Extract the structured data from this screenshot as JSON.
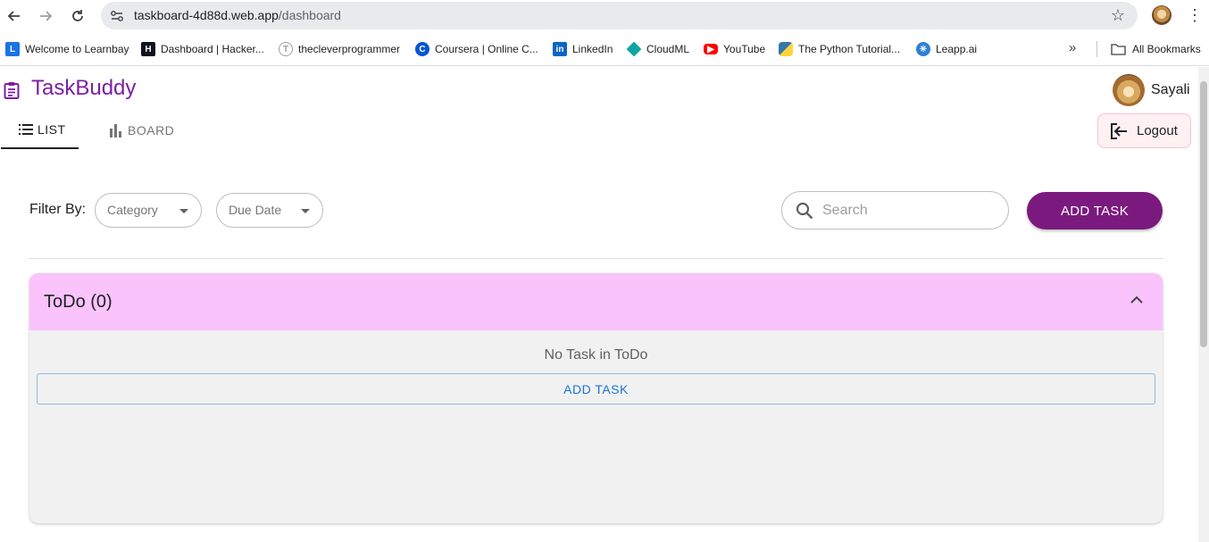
{
  "browser": {
    "url_host": "taskboard-4d88d.web.app",
    "url_path": "/dashboard",
    "bookmarks": [
      {
        "label": "Welcome to Learnbay",
        "icon": "learnbay-icon",
        "color": "#1a73e8"
      },
      {
        "label": "Dashboard | Hacker...",
        "icon": "hackerrank-icon",
        "color": "#0e141e"
      },
      {
        "label": "thecleverprogrammer",
        "icon": "theclever-icon",
        "color": "#9e9e9e"
      },
      {
        "label": "Coursera | Online C...",
        "icon": "coursera-icon",
        "color": "#0056d2"
      },
      {
        "label": "LinkedIn",
        "icon": "linkedin-icon",
        "color": "#0a66c2"
      },
      {
        "label": "CloudML",
        "icon": "cloudml-icon",
        "color": "#12a4a4"
      },
      {
        "label": "YouTube",
        "icon": "youtube-icon",
        "color": "#ff0000"
      },
      {
        "label": "The Python Tutorial...",
        "icon": "python-icon",
        "color": "#3776ab"
      },
      {
        "label": "Leapp.ai",
        "icon": "leapp-icon",
        "color": "#2d7fd3"
      }
    ],
    "all_bookmarks_label": "All Bookmarks"
  },
  "app": {
    "brand": "TaskBuddy",
    "brand_color": "#7b1fa2",
    "user_name": "Sayali",
    "logout_label": "Logout",
    "tabs": [
      {
        "label": "LIST",
        "active": true
      },
      {
        "label": "BOARD",
        "active": false
      }
    ],
    "filter_label": "Filter By:",
    "filters": [
      {
        "label": "Category"
      },
      {
        "label": "Due Date"
      }
    ],
    "search_placeholder": "Search",
    "add_task_label": "ADD TASK",
    "accent_color": "#7b1a7e",
    "sections": [
      {
        "title": "ToDo (0)",
        "header_color": "#fac3fb",
        "empty_message": "No Task in ToDo",
        "add_task_label": "ADD TASK"
      }
    ]
  }
}
